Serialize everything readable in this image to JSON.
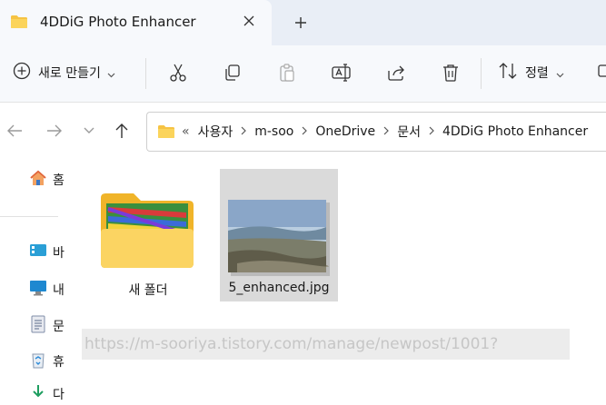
{
  "tab": {
    "title": "4DDiG Photo Enhancer",
    "icon": "folder-icon"
  },
  "toolbar": {
    "new_label": "새로 만들기",
    "sort_label": "정렬",
    "icons": [
      "cut-icon",
      "copy-icon",
      "paste-icon",
      "rename-icon",
      "share-icon",
      "delete-icon",
      "sort-icon"
    ]
  },
  "address": {
    "more": "«",
    "crumbs": [
      "사용자",
      "m-soo",
      "OneDrive",
      "문서",
      "4DDiG Photo Enhancer"
    ]
  },
  "sidebar": {
    "items": [
      {
        "label": "홈",
        "icon": "home-icon"
      },
      {
        "label": "바",
        "icon": "desktop-icon"
      },
      {
        "label": "내",
        "icon": "pc-icon"
      },
      {
        "label": "문",
        "icon": "document-icon"
      },
      {
        "label": "휴",
        "icon": "recycle-bin-icon"
      },
      {
        "label": "다",
        "icon": "download-icon"
      }
    ]
  },
  "files": [
    {
      "name": "새 폴더",
      "type": "folder",
      "selected": false
    },
    {
      "name": "5_enhanced.jpg",
      "type": "image",
      "selected": true
    }
  ],
  "watermark": "https://m-sooriya.tistory.com/manage/newpost/1001?",
  "colors": {
    "accent": "#0067c0",
    "folder": "#f8c843",
    "selection": "#dadada"
  }
}
